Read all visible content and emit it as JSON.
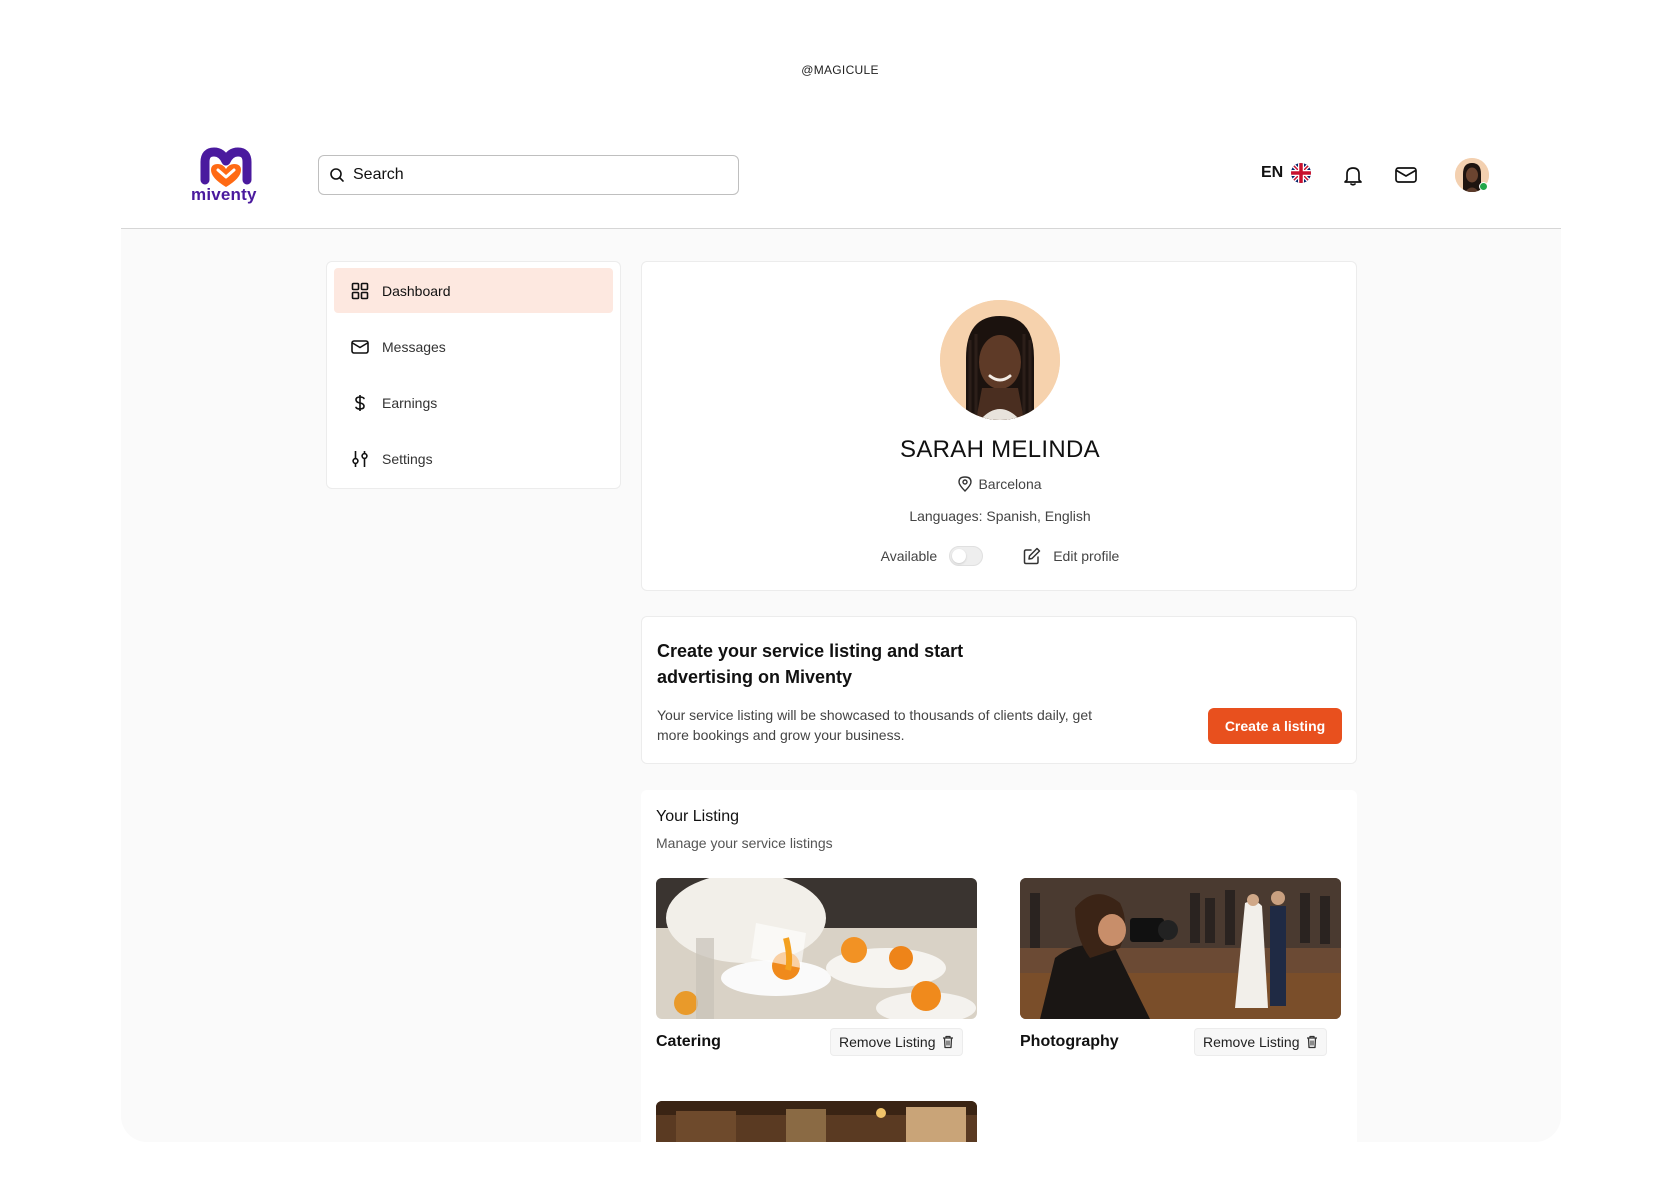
{
  "watermark": "@MAGICULE",
  "brand": {
    "name": "miventy",
    "primary": "#4a1a9e",
    "accent": "#ff6a14"
  },
  "header": {
    "search_placeholder": "Search",
    "language": "EN",
    "icons": [
      "uk-flag-icon",
      "bell-icon",
      "mail-icon"
    ]
  },
  "sidebar": {
    "items": [
      {
        "label": "Dashboard",
        "icon": "grid-icon",
        "active": true
      },
      {
        "label": "Messages",
        "icon": "mail-icon"
      },
      {
        "label": "Earnings",
        "icon": "dollar-icon"
      },
      {
        "label": "Settings",
        "icon": "sliders-icon"
      }
    ]
  },
  "profile": {
    "name": "SARAH MELINDA",
    "location": "Barcelona",
    "languages": "Languages: Spanish, English",
    "available_label": "Available",
    "available": false,
    "edit_label": "Edit profile"
  },
  "cta": {
    "title": "Create your service listing and start advertising on Miventy",
    "description": "Your service listing will be showcased to thousands of clients daily, get more bookings and grow your business.",
    "button": "Create a listing",
    "button_color": "#e8501e"
  },
  "listings": {
    "title": "Your Listing",
    "subtitle": "Manage your service listings",
    "items": [
      {
        "name": "Catering",
        "remove_label": "Remove Listing"
      },
      {
        "name": "Photography",
        "remove_label": "Remove Listing"
      }
    ]
  }
}
